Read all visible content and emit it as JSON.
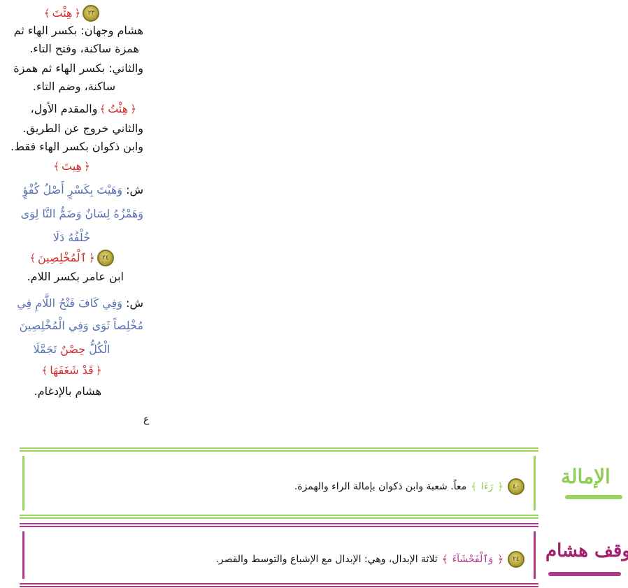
{
  "col": {
    "h1": "هِئْتَ",
    "h1_num": "٢٣",
    "l1": "هشام وجهان: بكسر الهاء ثم",
    "l2": "همزة ساكنة، وفتح التاء.",
    "l3": "والثاني: بكسر الهاء ثم همزة",
    "l4": "ساكنة، وضم التاء.",
    "h2": "هِئْتُ",
    "h2_tail": "والمقدم الأول،",
    "l5": "والثاني خروج عن الطريق.",
    "l6": "وابن ذكوان بكسر الهاء فقط.",
    "h3": "هِيتَ",
    "v1_prefix": "ش:",
    "v1": "وَهَيْتَ بِكَسْرٍ أَصْلُ كُفْؤٍ",
    "v2": "وَهَمْزُهُ لِسَانٌ وَضَمُّ التَّا لِوَى",
    "v3": "خُلْفُهُ دَلَا",
    "h4": "ٱلْمُخْلِصِينَ",
    "h4_num": "٢٤",
    "l7": "ابن عامر بكسر اللام.",
    "v4_prefix": "ش:",
    "v4": "وَفِي كَافَ فَتْحُ اللَّامِ فِي",
    "v5": "مُخْلِصاً ثَوَى وَفِي الْمُخْلِصِينَ",
    "v6a": "الْكُلُّ",
    "v6b": "حِصْنٌ",
    "v6c": "تَجَمَّلَا",
    "h5": "قَدْ شَغَفَهَا",
    "l8": "هشام بالإدغام.",
    "mark": "ع"
  },
  "imala": {
    "heading": "الإمالة",
    "num": "٤٠",
    "word": "رَءَا",
    "text": "معاً. شعبة وابن ذكوان بإمالة الراء والهمزة."
  },
  "waqf": {
    "heading": "وقف هشام",
    "num": "٢٤",
    "word": "وَٱلْفَحْشَآءَ",
    "text": "ثلاثة الإبدال، وهي: الإبدال مع الإشباع والتوسط والقصر."
  },
  "colors": {
    "red": "#d42a2a",
    "blue": "#5672b4",
    "green_frame": "#9bd35e",
    "purple_frame": "#b03a8a",
    "medallion": "#b8a93c"
  }
}
